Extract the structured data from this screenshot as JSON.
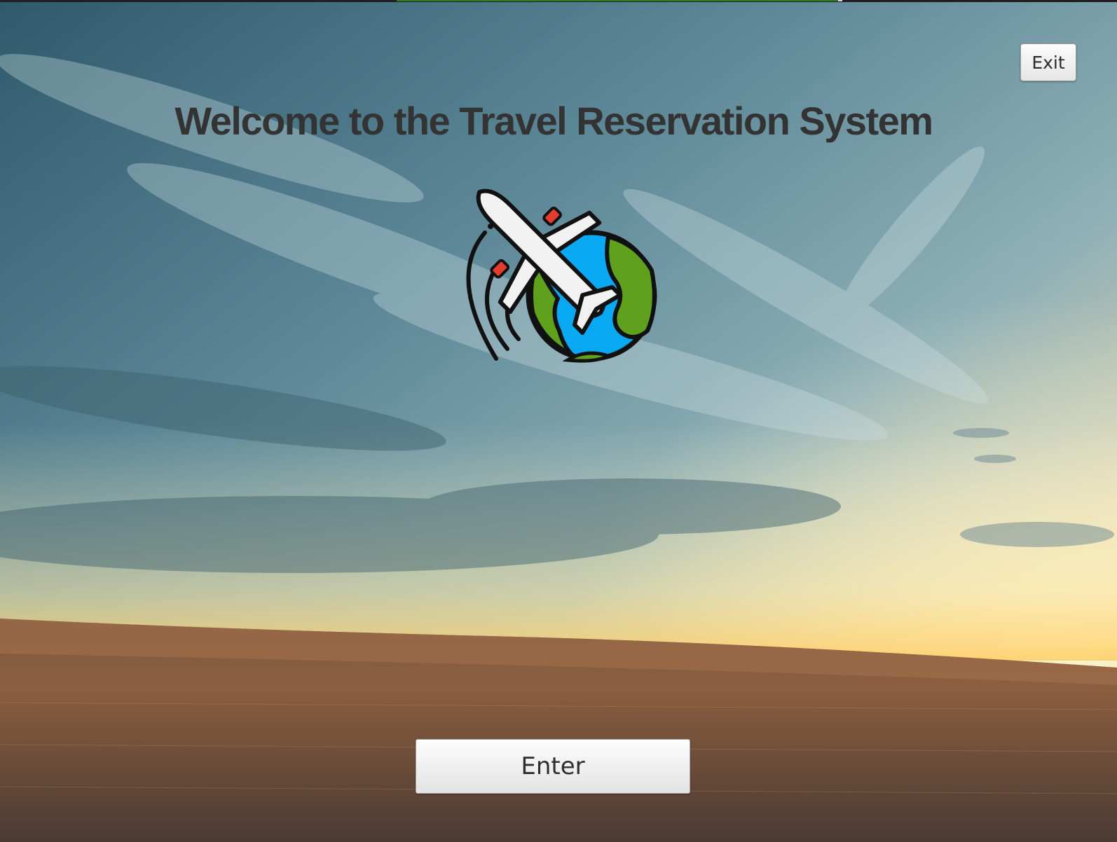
{
  "window": {
    "title": "Welcome to the Travel Reservation System"
  },
  "toolbar": {
    "exit_label": "Exit"
  },
  "main": {
    "enter_label": "Enter",
    "logo_icon": "plane-globe-icon"
  },
  "colors": {
    "title_text": "#333333",
    "globe_ocean": "#08a9f2",
    "globe_land": "#5fa01c",
    "plane_body": "#f2f2f2",
    "plane_engine": "#e53b2c"
  }
}
